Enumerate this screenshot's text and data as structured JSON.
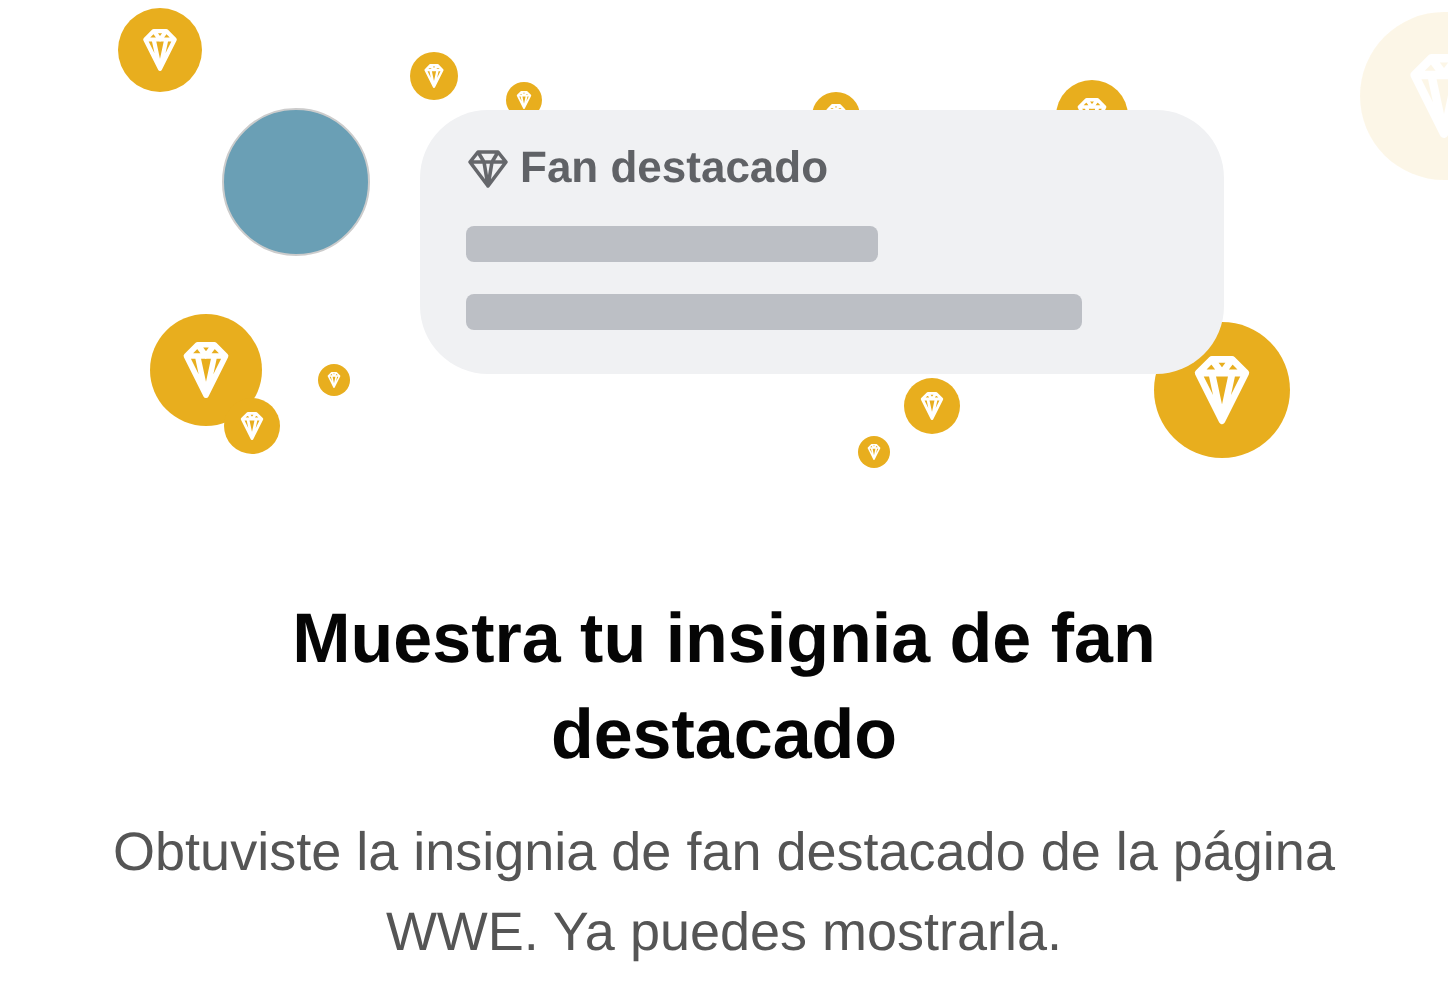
{
  "badge_card": {
    "label": "Fan destacado"
  },
  "title": "Muestra tu insignia de fan destacado",
  "description": "Obtuviste la insignia de fan destacado de la página WWE. Ya puedes mostrarla."
}
